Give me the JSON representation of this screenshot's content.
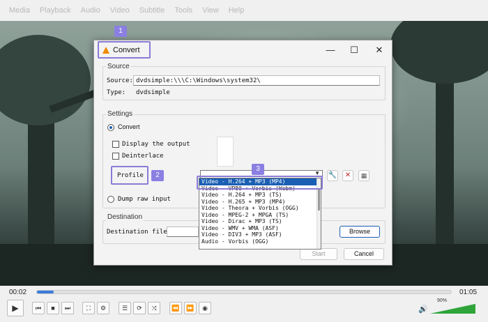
{
  "menubar": [
    "Media",
    "Playback",
    "Audio",
    "Video",
    "Subtitle",
    "Tools",
    "View",
    "Help"
  ],
  "dialog": {
    "title": "Convert",
    "source": {
      "group_label": "Source",
      "source_label": "Source:",
      "source_value": "dvdsimple:\\\\\\C:\\Windows\\system32\\",
      "type_label": "Type:",
      "type_value": "dvdsimple"
    },
    "settings": {
      "group_label": "Settings",
      "convert_label": "Convert",
      "display_output_label": "Display the output",
      "deinterlace_label": "Deinterlace",
      "profile_label": "Profile",
      "dump_raw_label": "Dump raw input"
    },
    "profile_options": [
      "Video - H.264 + MP3 (MP4)",
      "Video - VP80 + Vorbis (Webm)",
      "Video - H.264 + MP3 (TS)",
      "Video - H.265 + MP3 (MP4)",
      "Video - Theora + Vorbis (OGG)",
      "Video - MPEG-2 + MPGA (TS)",
      "Video - Dirac + MP3 (TS)",
      "Video - WMV + WMA (ASF)",
      "Video - DIV3 + MP3 (ASF)",
      "Audio - Vorbis (OGG)"
    ],
    "destination": {
      "group_label": "Destination",
      "file_label": "Destination file:",
      "browse_label": "Browse"
    },
    "start_label": "Start",
    "cancel_label": "Cancel"
  },
  "badges": {
    "one": "1",
    "two": "2",
    "three": "3"
  },
  "player": {
    "time_elapsed": "00:02",
    "time_total": "01:05",
    "volume": "90%",
    "progress_fraction": 0.04,
    "volume_fraction": 0.9
  },
  "colors": {
    "accent": "#1a5fb4",
    "highlight": "#8b7fe2",
    "vlc_cone": "#f08a00"
  }
}
